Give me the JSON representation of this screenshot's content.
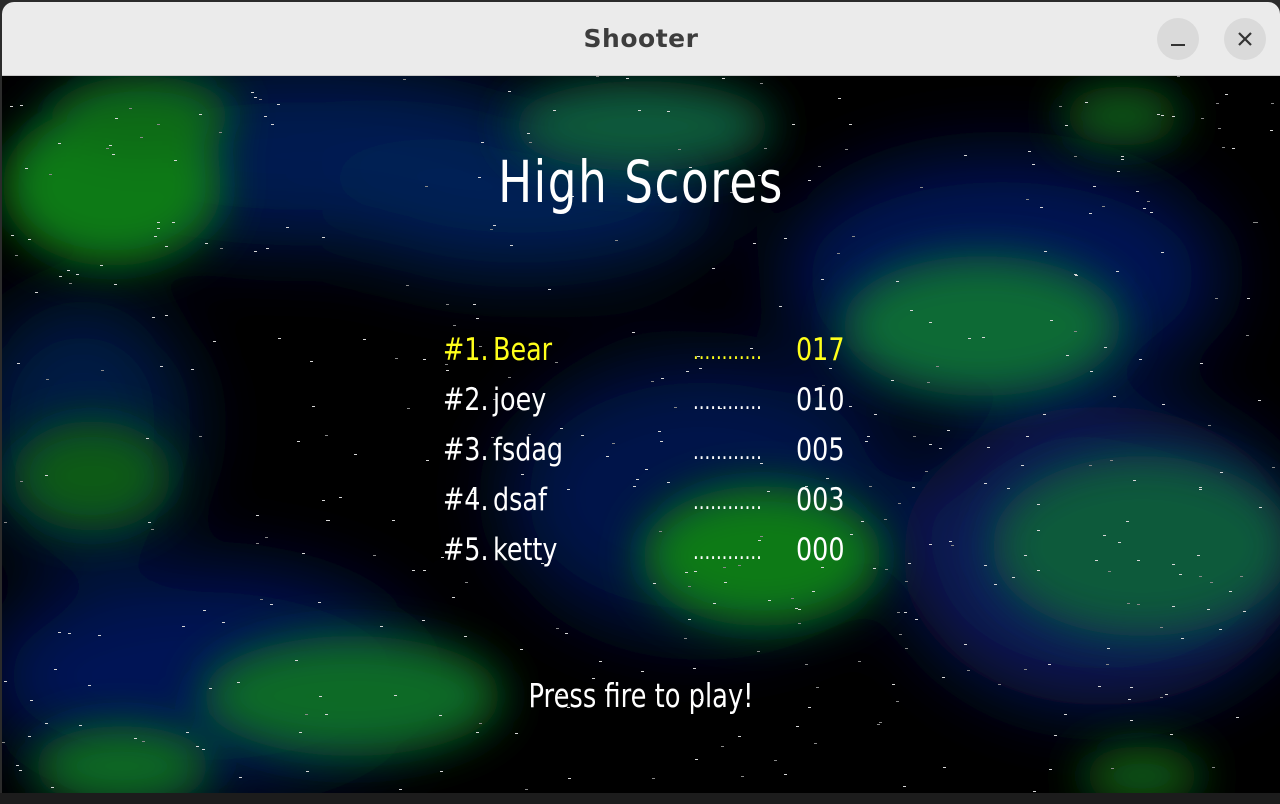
{
  "window": {
    "title": "Shooter"
  },
  "screen": {
    "heading": "High Scores",
    "prompt": "Press fire to play!",
    "scores": [
      {
        "rank": "#1.",
        "name": "Bear",
        "dots": "............",
        "score": "017",
        "highlight": true
      },
      {
        "rank": "#2.",
        "name": "joey",
        "dots": "............",
        "score": "010",
        "highlight": false
      },
      {
        "rank": "#3.",
        "name": "fsdag",
        "dots": "............",
        "score": "005",
        "highlight": false
      },
      {
        "rank": "#4.",
        "name": "dsaf",
        "dots": "............",
        "score": "003",
        "highlight": false
      },
      {
        "rank": "#5.",
        "name": "ketty",
        "dots": "............",
        "score": "000",
        "highlight": false
      }
    ]
  },
  "colors": {
    "highlight": "#ffff1a",
    "text": "#ffffff",
    "nebula_green": "#0a8a1a",
    "nebula_blue": "#0a1a6a"
  },
  "icons": {
    "minimize": "minimize-icon",
    "close": "close-icon"
  }
}
